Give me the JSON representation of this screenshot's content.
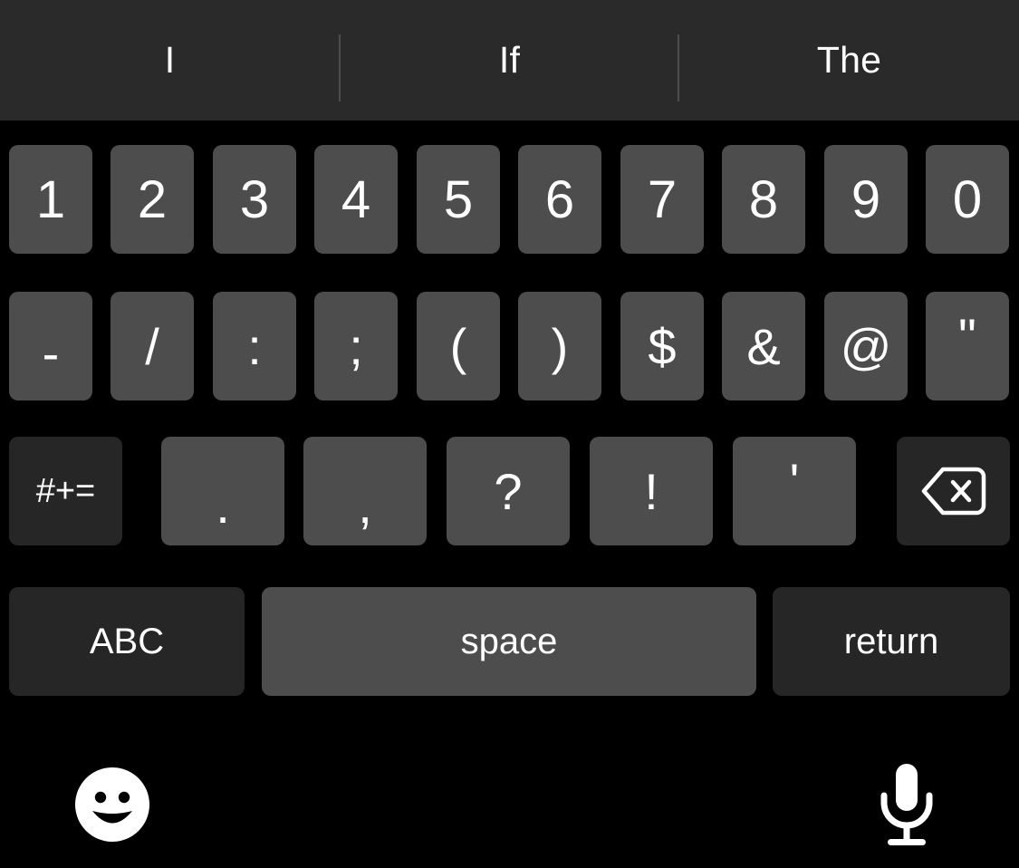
{
  "keyboard": {
    "name": "ios-symbol-keyboard",
    "background_color": "#000000",
    "key_color": "#4d4d4d",
    "special_key_color": "#262626",
    "text_color": "#ffffff"
  },
  "predictive_bar": {
    "background_color": "#2a2a2a",
    "divider_color": "#4d4d4d",
    "suggestions": [
      {
        "label": "I"
      },
      {
        "label": "If"
      },
      {
        "label": "The"
      }
    ]
  },
  "rows": {
    "numbers": [
      {
        "label": "1",
        "name": "key-1"
      },
      {
        "label": "2",
        "name": "key-2"
      },
      {
        "label": "3",
        "name": "key-3"
      },
      {
        "label": "4",
        "name": "key-4"
      },
      {
        "label": "5",
        "name": "key-5"
      },
      {
        "label": "6",
        "name": "key-6"
      },
      {
        "label": "7",
        "name": "key-7"
      },
      {
        "label": "8",
        "name": "key-8"
      },
      {
        "label": "9",
        "name": "key-9"
      },
      {
        "label": "0",
        "name": "key-0"
      }
    ],
    "symbols": [
      {
        "label": "-",
        "name": "key-hyphen"
      },
      {
        "label": "/",
        "name": "key-slash"
      },
      {
        "label": ":",
        "name": "key-colon"
      },
      {
        "label": ";",
        "name": "key-semicolon"
      },
      {
        "label": "(",
        "name": "key-left-paren"
      },
      {
        "label": ")",
        "name": "key-right-paren"
      },
      {
        "label": "$",
        "name": "key-dollar"
      },
      {
        "label": "&",
        "name": "key-ampersand"
      },
      {
        "label": "@",
        "name": "key-at-sign"
      },
      {
        "label": "\"",
        "name": "key-double-quote"
      }
    ],
    "punctuation": [
      {
        "label": ".",
        "name": "key-period"
      },
      {
        "label": ",",
        "name": "key-comma"
      },
      {
        "label": "?",
        "name": "key-question-mark"
      },
      {
        "label": "!",
        "name": "key-exclamation-mark"
      },
      {
        "label": "'",
        "name": "key-apostrophe"
      }
    ]
  },
  "special_keys": {
    "more_symbols": {
      "label": "#+=",
      "name": "more-symbols-key"
    },
    "backspace": {
      "icon": "backspace-icon",
      "name": "backspace-key"
    },
    "letters": {
      "label": "ABC",
      "name": "abc-key"
    },
    "space": {
      "label": "space",
      "name": "space-key"
    },
    "return": {
      "label": "return",
      "name": "return-key"
    }
  },
  "bottom_bar": {
    "emoji": {
      "icon": "emoji-smiley-icon",
      "name": "emoji-key"
    },
    "dictation": {
      "icon": "microphone-icon",
      "name": "dictation-key"
    }
  }
}
